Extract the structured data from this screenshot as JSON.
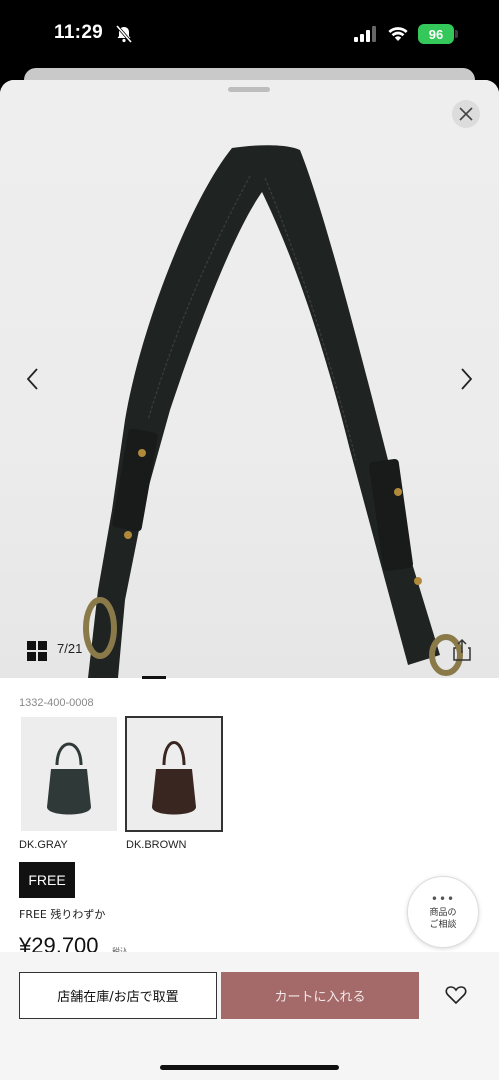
{
  "status_bar": {
    "time": "11:29",
    "battery": "96",
    "icons": [
      "bell-slash-icon",
      "signal-icon",
      "wifi-icon",
      "battery-icon"
    ]
  },
  "gallery": {
    "counter": "7/21",
    "icons": [
      "close-icon",
      "chevron-left-icon",
      "chevron-right-icon",
      "grid-icon",
      "share-icon"
    ]
  },
  "product": {
    "sku": "1332-400-0008",
    "colors": [
      {
        "label": "DK.GRAY",
        "swatch": "#2f3a38",
        "selected": false
      },
      {
        "label": "DK.BROWN",
        "swatch": "#3a2620",
        "selected": true
      }
    ],
    "size": "FREE",
    "stock_text": "FREE 残りわずか",
    "price": "¥29,700",
    "tax_label": "税込"
  },
  "consult": {
    "dots": "•••",
    "label": "商品の\nご相談"
  },
  "actions": {
    "store_button": "店舗在庫/お店で取置",
    "cart_button": "カートに入れる",
    "favorite_icon": "heart-icon"
  },
  "colors": {
    "accent": "#a46a6a",
    "battery": "#34c759",
    "strap": "#1f2321"
  }
}
